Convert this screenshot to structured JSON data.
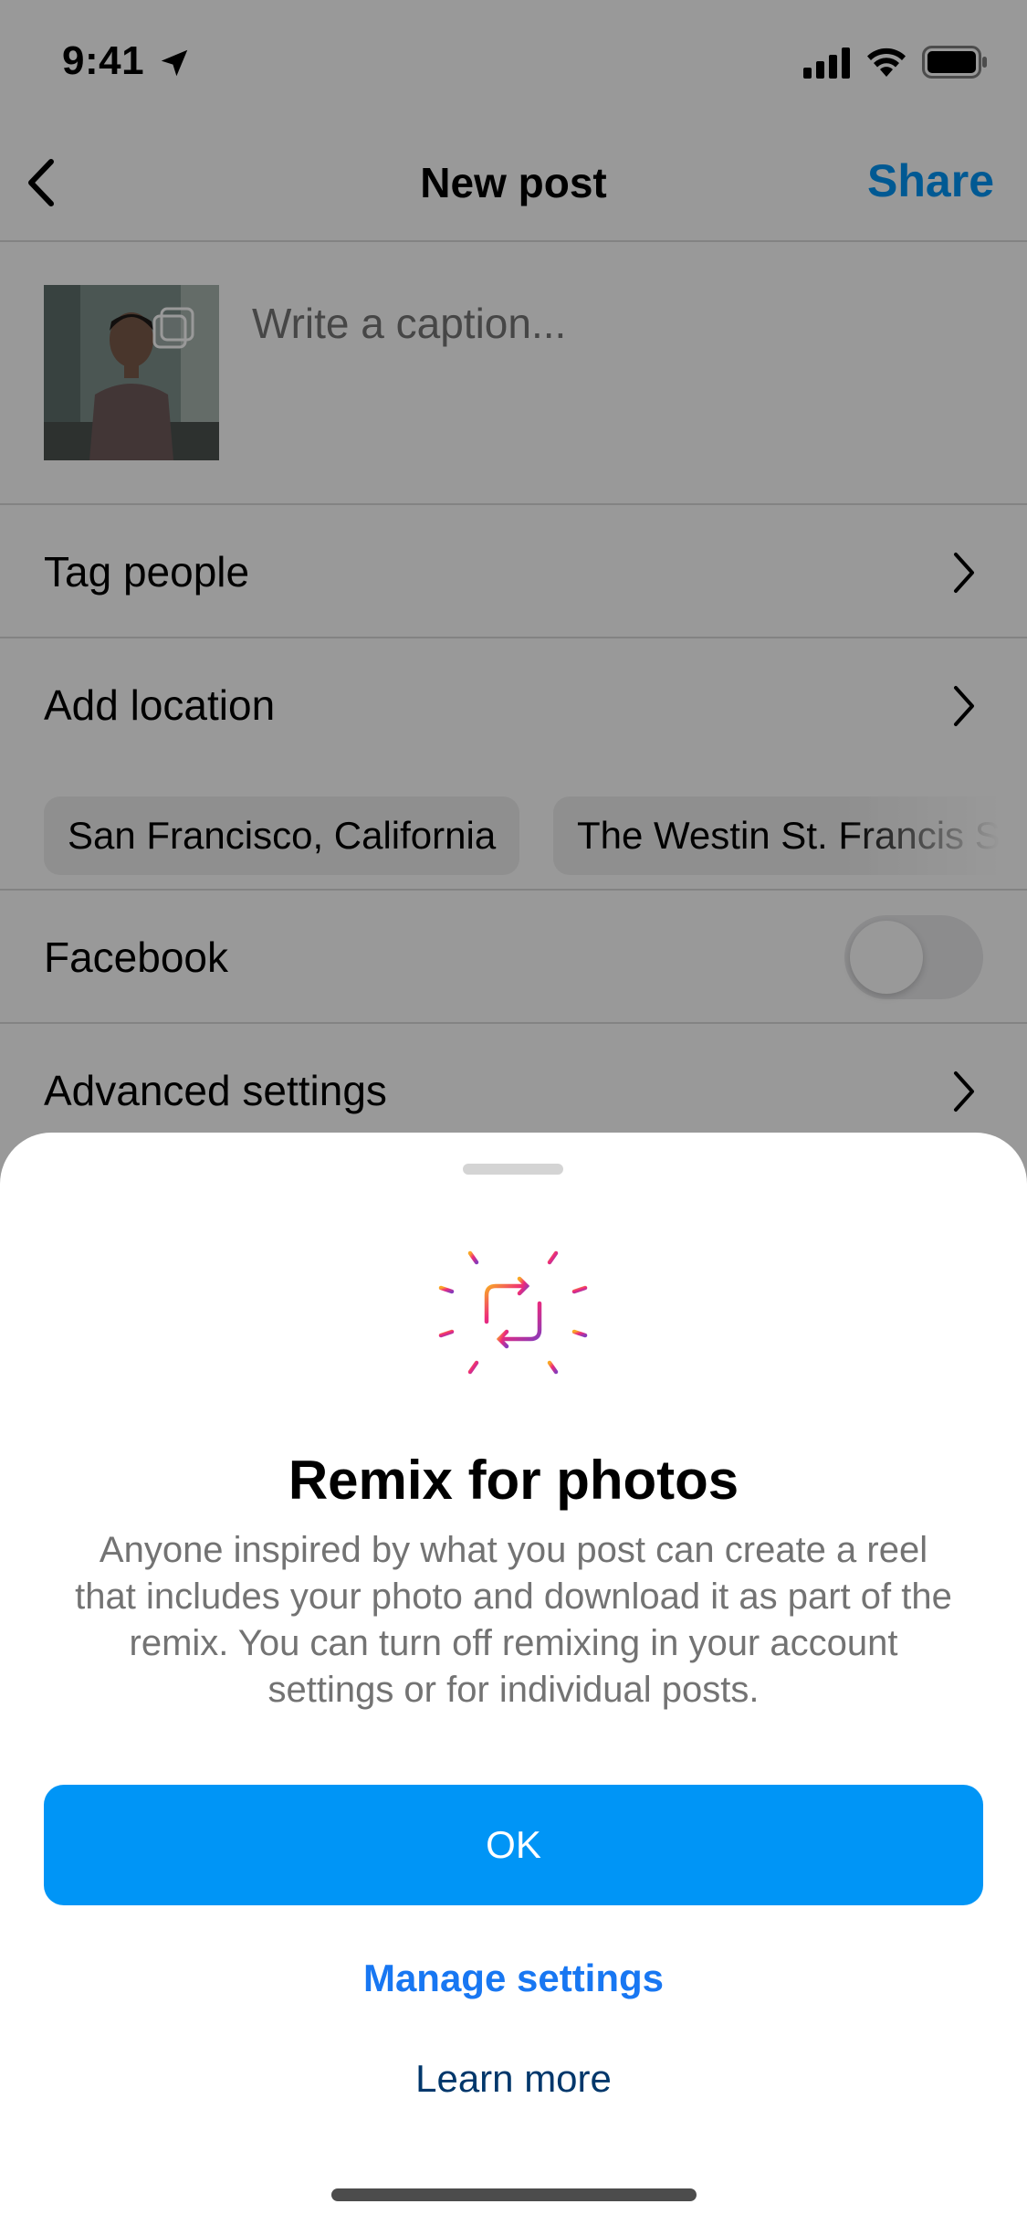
{
  "status_bar": {
    "time": "9:41"
  },
  "nav": {
    "title": "New post",
    "share_label": "Share"
  },
  "caption": {
    "placeholder": "Write a caption..."
  },
  "rows": {
    "tag_people": "Tag people",
    "add_location": "Add location",
    "facebook": "Facebook",
    "advanced_settings": "Advanced settings"
  },
  "location_suggestions": [
    "San Francisco, California",
    "The Westin St. Francis Sa"
  ],
  "facebook_toggle": {
    "on": false
  },
  "sheet": {
    "title": "Remix for photos",
    "body": "Anyone inspired by what you post can create a reel that includes your photo and download it as part of the remix. You can turn off remixing in your account settings or for individual posts.",
    "ok_label": "OK",
    "manage_label": "Manage settings",
    "learn_label": "Learn more"
  },
  "colors": {
    "accent": "#0095f6",
    "link": "#1877f2",
    "learn_more": "#00376b"
  },
  "icons": [
    "location-arrow-icon",
    "signal-icon",
    "wifi-icon",
    "battery-icon",
    "back-chevron-icon",
    "multi-select-icon",
    "chevron-right-icon",
    "remix-icon"
  ]
}
